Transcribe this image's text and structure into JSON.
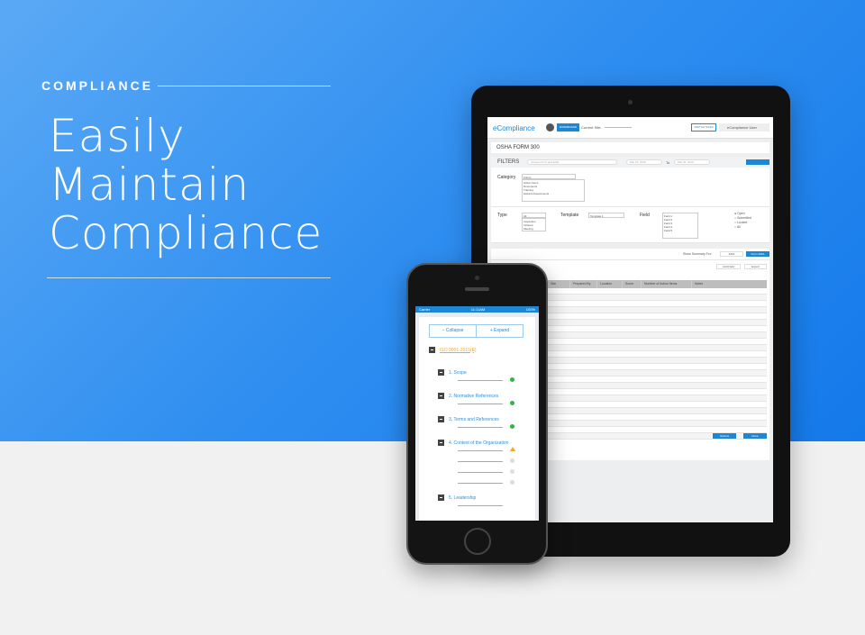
{
  "hero": {
    "eyebrow": "COMPLIANCE",
    "headline_lines": [
      "Easily",
      "Maintain",
      "Compliance"
    ]
  },
  "tablet": {
    "header": {
      "logo": "eCompliance",
      "dashboard_button": "DASHBOARD",
      "current_site_label": "Current Site:",
      "switch_button": "SWITCH SITES",
      "user": "eCompliance User"
    },
    "form_title": "OSHA FORM 300",
    "filters": {
      "label": "FILTERS",
      "search_placeholder": "Access forms and fields",
      "date_from": "Mar 25, 2016",
      "to": "To",
      "date_to": "Mar 30, 2016",
      "apply": "Apply"
    },
    "category": {
      "label": "Category",
      "selected": "Forms",
      "options": [
        "Action Items",
        "Documents",
        "Training",
        "Hazard Assessments"
      ]
    },
    "type": {
      "label": "Type",
      "selected": "All",
      "options": [
        "Inspection",
        "Incident",
        "Meeting"
      ]
    },
    "template": {
      "label": "Template",
      "selected": "Template 1"
    },
    "field": {
      "label": "Field",
      "options": [
        "Field 1",
        "Field 2",
        "Field 3",
        "Field 4",
        "Field 5"
      ]
    },
    "status_options": [
      "Open",
      "Submitted",
      "Locked",
      "All"
    ],
    "summary": {
      "label": "Show Summary For:",
      "year": "2016",
      "form_button": "Form 300A"
    },
    "table_actions": {
      "add_field": "Add Field",
      "export": "Export"
    },
    "columns": [
      "Site",
      "Prepared By",
      "Location",
      "Score",
      "Number of Action Items",
      "Notes"
    ],
    "footer": {
      "options": "Options",
      "done": "Done"
    }
  },
  "phone": {
    "status": {
      "carrier": "Carrier",
      "time": "11:11AM",
      "battery": "100%"
    },
    "collapse": "− Collapse",
    "expand": "+ Expand",
    "root": "ISO 9001-2015(E)",
    "sections": [
      "1. Scope",
      "2. Normative References",
      "3. Terms and References",
      "4. Context of the Organization",
      "5. Leadership"
    ],
    "colors": {
      "complete": "#2eb54a",
      "warning": "#f5a623",
      "pending": "#dddddd",
      "accent": "#1d87d6",
      "root": "#f5a623"
    }
  }
}
